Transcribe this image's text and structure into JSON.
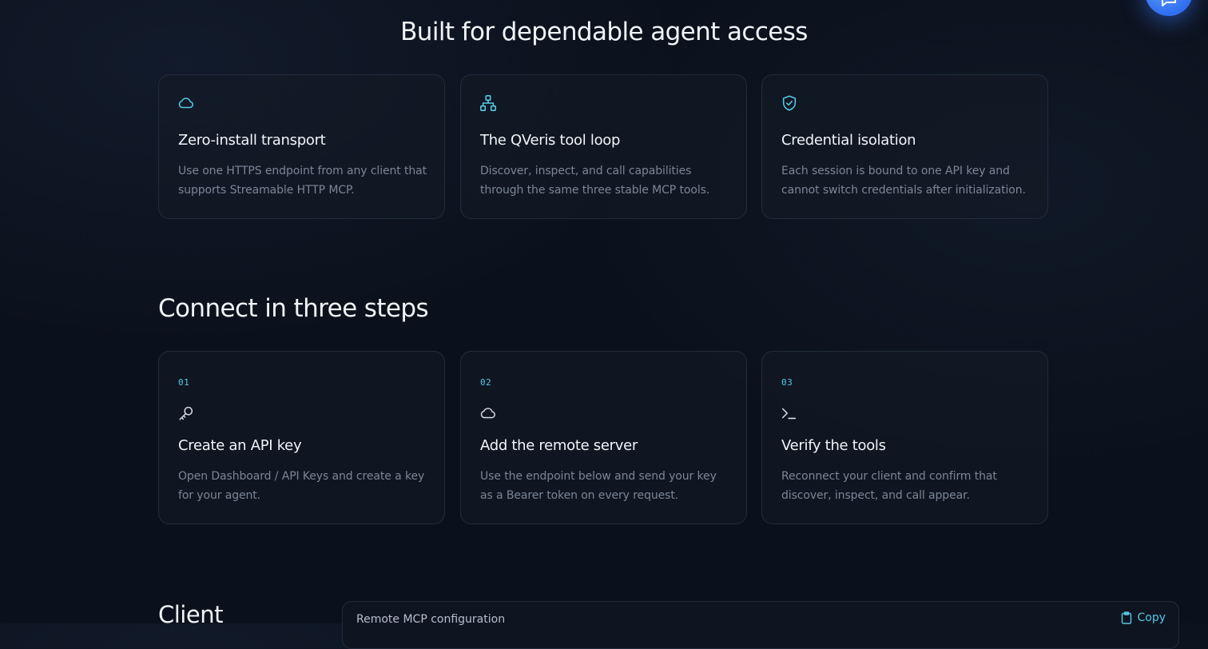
{
  "features": {
    "title": "Built for dependable agent access",
    "cards": [
      {
        "icon": "cloud-icon",
        "title": "Zero-install transport",
        "description": "Use one HTTPS endpoint from any client that supports Streamable HTTP MCP."
      },
      {
        "icon": "network-icon",
        "title": "The QVeris tool loop",
        "description": "Discover, inspect, and call capabilities through the same three stable MCP tools."
      },
      {
        "icon": "shield-check-icon",
        "title": "Credential isolation",
        "description": "Each session is bound to one API key and cannot switch credentials after initialization."
      }
    ]
  },
  "steps": {
    "title": "Connect in three steps",
    "items": [
      {
        "number": "01",
        "icon": "key-icon",
        "title": "Create an API key",
        "description": "Open Dashboard / API Keys and create a key for your agent."
      },
      {
        "number": "02",
        "icon": "cloud-icon",
        "title": "Add the remote server",
        "description": "Use the endpoint below and send your key as a Bearer token on every request."
      },
      {
        "number": "03",
        "icon": "terminal-icon",
        "title": "Verify the tools",
        "description": "Reconnect your client and confirm that discover, inspect, and call appear."
      }
    ]
  },
  "client": {
    "title": "Client",
    "config_label": "Remote MCP configuration",
    "copy_label": "Copy"
  },
  "colors": {
    "accent": "#57c8e3",
    "background": "#0b111c",
    "card_border": "#222c3b",
    "fab": "#3b7bff"
  }
}
